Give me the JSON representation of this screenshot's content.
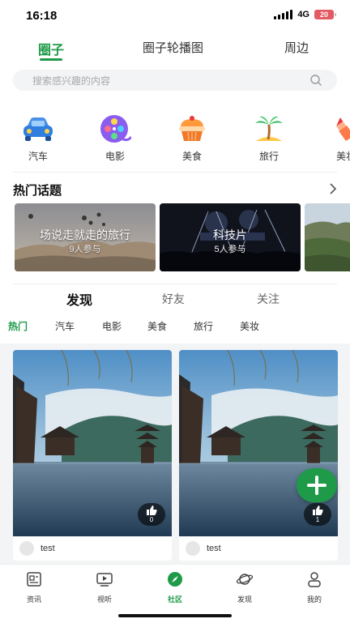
{
  "status_bar": {
    "time": "16:18",
    "network": "4G",
    "battery": "20"
  },
  "top_tabs": [
    {
      "label": "圈子",
      "active": true
    },
    {
      "label": "圈子轮播图",
      "active": false
    },
    {
      "label": "周边",
      "active": false
    }
  ],
  "search": {
    "placeholder": "搜索感兴趣的内容"
  },
  "categories": [
    {
      "label": "汽车",
      "icon": "car-icon"
    },
    {
      "label": "电影",
      "icon": "film-reel-icon"
    },
    {
      "label": "美食",
      "icon": "cake-icon"
    },
    {
      "label": "旅行",
      "icon": "palm-tree-icon"
    },
    {
      "label": "美妆",
      "icon": "lipstick-icon"
    }
  ],
  "hot_topics": {
    "title": "热门话题",
    "items": [
      {
        "title": "场说走就走的旅行",
        "count": "9人参与"
      },
      {
        "title": "科技片",
        "count": "5人参与"
      },
      {
        "title": "",
        "count": ""
      }
    ]
  },
  "feed_tabs": [
    {
      "label": "发现",
      "active": true
    },
    {
      "label": "好友",
      "active": false
    },
    {
      "label": "关注",
      "active": false
    }
  ],
  "sub_categories": [
    {
      "label": "热门",
      "active": true
    },
    {
      "label": "汽车",
      "active": false
    },
    {
      "label": "电影",
      "active": false
    },
    {
      "label": "美食",
      "active": false
    },
    {
      "label": "旅行",
      "active": false
    },
    {
      "label": "美妆",
      "active": false
    }
  ],
  "posts": [
    {
      "author": "test",
      "likes": "0"
    },
    {
      "author": "test",
      "likes": "1"
    }
  ],
  "bottom_nav": [
    {
      "label": "资讯",
      "icon": "news-icon",
      "active": false
    },
    {
      "label": "视听",
      "icon": "video-icon",
      "active": false
    },
    {
      "label": "社区",
      "icon": "compass-icon",
      "active": true
    },
    {
      "label": "发现",
      "icon": "planet-icon",
      "active": false
    },
    {
      "label": "我的",
      "icon": "profile-icon",
      "active": false
    }
  ],
  "colors": {
    "accent": "#1f9a49",
    "battery": "#e45a63"
  }
}
